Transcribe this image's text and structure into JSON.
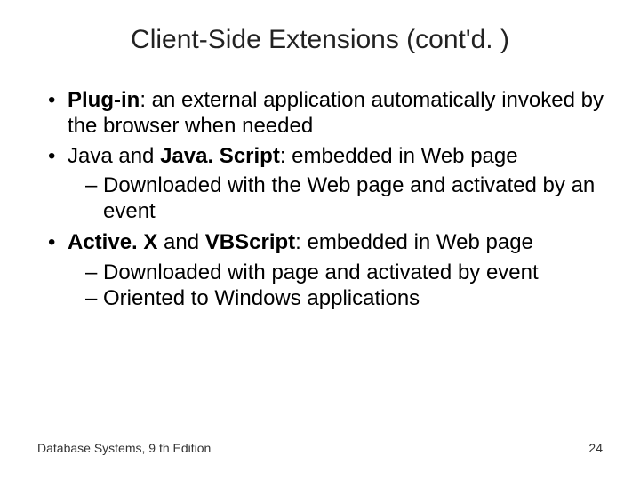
{
  "title": "Client-Side Extensions (cont'd. )",
  "bullets": [
    {
      "bold1": "Plug-in",
      "tail1": ": an external application automatically invoked by the browser when needed",
      "sub": []
    },
    {
      "pre": "Java and ",
      "bold1": "Java. Script",
      "tail1": ": embedded in Web page",
      "sub": [
        "Downloaded with the Web page and activated by an event"
      ]
    },
    {
      "bold1": "Active. X",
      "mid": " and ",
      "bold2": "VBScript",
      "tail1": ": embedded in Web page",
      "sub": [
        "Downloaded with page and activated by event",
        "Oriented to Windows applications"
      ]
    }
  ],
  "footer_left": "Database Systems, 9 th Edition",
  "footer_right": "24"
}
